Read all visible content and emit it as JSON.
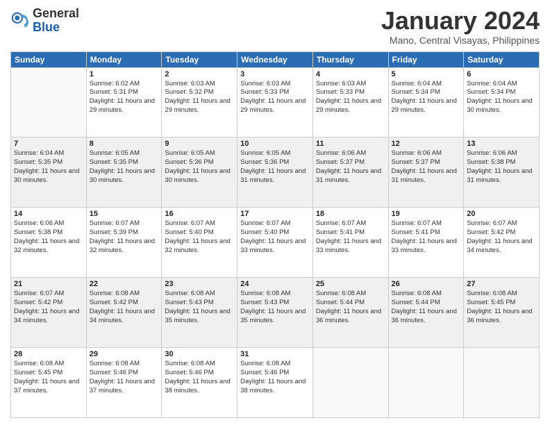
{
  "logo": {
    "line1": "General",
    "line2": "Blue"
  },
  "title": "January 2024",
  "subtitle": "Mano, Central Visayas, Philippines",
  "weekdays": [
    "Sunday",
    "Monday",
    "Tuesday",
    "Wednesday",
    "Thursday",
    "Friday",
    "Saturday"
  ],
  "weeks": [
    [
      {
        "day": "",
        "sunrise": "",
        "sunset": "",
        "daylight": ""
      },
      {
        "day": "1",
        "sunrise": "Sunrise: 6:02 AM",
        "sunset": "Sunset: 5:31 PM",
        "daylight": "Daylight: 11 hours and 29 minutes."
      },
      {
        "day": "2",
        "sunrise": "Sunrise: 6:03 AM",
        "sunset": "Sunset: 5:32 PM",
        "daylight": "Daylight: 11 hours and 29 minutes."
      },
      {
        "day": "3",
        "sunrise": "Sunrise: 6:03 AM",
        "sunset": "Sunset: 5:33 PM",
        "daylight": "Daylight: 11 hours and 29 minutes."
      },
      {
        "day": "4",
        "sunrise": "Sunrise: 6:03 AM",
        "sunset": "Sunset: 5:33 PM",
        "daylight": "Daylight: 11 hours and 29 minutes."
      },
      {
        "day": "5",
        "sunrise": "Sunrise: 6:04 AM",
        "sunset": "Sunset: 5:34 PM",
        "daylight": "Daylight: 11 hours and 29 minutes."
      },
      {
        "day": "6",
        "sunrise": "Sunrise: 6:04 AM",
        "sunset": "Sunset: 5:34 PM",
        "daylight": "Daylight: 11 hours and 30 minutes."
      }
    ],
    [
      {
        "day": "7",
        "sunrise": "Sunrise: 6:04 AM",
        "sunset": "Sunset: 5:35 PM",
        "daylight": "Daylight: 11 hours and 30 minutes."
      },
      {
        "day": "8",
        "sunrise": "Sunrise: 6:05 AM",
        "sunset": "Sunset: 5:35 PM",
        "daylight": "Daylight: 11 hours and 30 minutes."
      },
      {
        "day": "9",
        "sunrise": "Sunrise: 6:05 AM",
        "sunset": "Sunset: 5:36 PM",
        "daylight": "Daylight: 11 hours and 30 minutes."
      },
      {
        "day": "10",
        "sunrise": "Sunrise: 6:05 AM",
        "sunset": "Sunset: 5:36 PM",
        "daylight": "Daylight: 11 hours and 31 minutes."
      },
      {
        "day": "11",
        "sunrise": "Sunrise: 6:06 AM",
        "sunset": "Sunset: 5:37 PM",
        "daylight": "Daylight: 11 hours and 31 minutes."
      },
      {
        "day": "12",
        "sunrise": "Sunrise: 6:06 AM",
        "sunset": "Sunset: 5:37 PM",
        "daylight": "Daylight: 11 hours and 31 minutes."
      },
      {
        "day": "13",
        "sunrise": "Sunrise: 6:06 AM",
        "sunset": "Sunset: 5:38 PM",
        "daylight": "Daylight: 11 hours and 31 minutes."
      }
    ],
    [
      {
        "day": "14",
        "sunrise": "Sunrise: 6:06 AM",
        "sunset": "Sunset: 5:38 PM",
        "daylight": "Daylight: 11 hours and 32 minutes."
      },
      {
        "day": "15",
        "sunrise": "Sunrise: 6:07 AM",
        "sunset": "Sunset: 5:39 PM",
        "daylight": "Daylight: 11 hours and 32 minutes."
      },
      {
        "day": "16",
        "sunrise": "Sunrise: 6:07 AM",
        "sunset": "Sunset: 5:40 PM",
        "daylight": "Daylight: 11 hours and 32 minutes."
      },
      {
        "day": "17",
        "sunrise": "Sunrise: 6:07 AM",
        "sunset": "Sunset: 5:40 PM",
        "daylight": "Daylight: 11 hours and 33 minutes."
      },
      {
        "day": "18",
        "sunrise": "Sunrise: 6:07 AM",
        "sunset": "Sunset: 5:41 PM",
        "daylight": "Daylight: 11 hours and 33 minutes."
      },
      {
        "day": "19",
        "sunrise": "Sunrise: 6:07 AM",
        "sunset": "Sunset: 5:41 PM",
        "daylight": "Daylight: 11 hours and 33 minutes."
      },
      {
        "day": "20",
        "sunrise": "Sunrise: 6:07 AM",
        "sunset": "Sunset: 5:42 PM",
        "daylight": "Daylight: 11 hours and 34 minutes."
      }
    ],
    [
      {
        "day": "21",
        "sunrise": "Sunrise: 6:07 AM",
        "sunset": "Sunset: 5:42 PM",
        "daylight": "Daylight: 11 hours and 34 minutes."
      },
      {
        "day": "22",
        "sunrise": "Sunrise: 6:08 AM",
        "sunset": "Sunset: 5:42 PM",
        "daylight": "Daylight: 11 hours and 34 minutes."
      },
      {
        "day": "23",
        "sunrise": "Sunrise: 6:08 AM",
        "sunset": "Sunset: 5:43 PM",
        "daylight": "Daylight: 11 hours and 35 minutes."
      },
      {
        "day": "24",
        "sunrise": "Sunrise: 6:08 AM",
        "sunset": "Sunset: 5:43 PM",
        "daylight": "Daylight: 11 hours and 35 minutes."
      },
      {
        "day": "25",
        "sunrise": "Sunrise: 6:08 AM",
        "sunset": "Sunset: 5:44 PM",
        "daylight": "Daylight: 11 hours and 36 minutes."
      },
      {
        "day": "26",
        "sunrise": "Sunrise: 6:08 AM",
        "sunset": "Sunset: 5:44 PM",
        "daylight": "Daylight: 11 hours and 36 minutes."
      },
      {
        "day": "27",
        "sunrise": "Sunrise: 6:08 AM",
        "sunset": "Sunset: 5:45 PM",
        "daylight": "Daylight: 11 hours and 36 minutes."
      }
    ],
    [
      {
        "day": "28",
        "sunrise": "Sunrise: 6:08 AM",
        "sunset": "Sunset: 5:45 PM",
        "daylight": "Daylight: 11 hours and 37 minutes."
      },
      {
        "day": "29",
        "sunrise": "Sunrise: 6:08 AM",
        "sunset": "Sunset: 5:46 PM",
        "daylight": "Daylight: 11 hours and 37 minutes."
      },
      {
        "day": "30",
        "sunrise": "Sunrise: 6:08 AM",
        "sunset": "Sunset: 5:46 PM",
        "daylight": "Daylight: 11 hours and 38 minutes."
      },
      {
        "day": "31",
        "sunrise": "Sunrise: 6:08 AM",
        "sunset": "Sunset: 5:46 PM",
        "daylight": "Daylight: 11 hours and 38 minutes."
      },
      {
        "day": "",
        "sunrise": "",
        "sunset": "",
        "daylight": ""
      },
      {
        "day": "",
        "sunrise": "",
        "sunset": "",
        "daylight": ""
      },
      {
        "day": "",
        "sunrise": "",
        "sunset": "",
        "daylight": ""
      }
    ]
  ]
}
